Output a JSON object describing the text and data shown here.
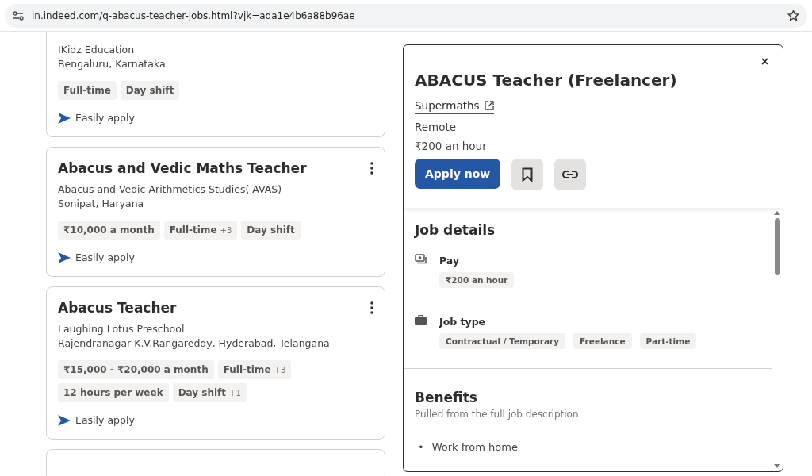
{
  "address_bar": {
    "url": "in.indeed.com/q-abacus-teacher-jobs.html?vjk=ada1e4b6a88b96ae",
    "bookmarked": false
  },
  "job_cards": [
    {
      "cut_top": true,
      "company": "IKidz Education",
      "location": "Bengaluru, Karnataka",
      "tags": [
        {
          "label": "Full-time"
        },
        {
          "label": "Day shift"
        }
      ],
      "apply": "Easily apply"
    },
    {
      "cut_top": false,
      "title": "Abacus and Vedic Maths Teacher",
      "company": "Abacus and Vedic Arithmetics Studies( AVAS)",
      "location": "Sonipat, Haryana",
      "tags": [
        {
          "label": "₹10,000 a month"
        },
        {
          "label": "Full-time",
          "more": "+3"
        },
        {
          "label": "Day shift"
        }
      ],
      "apply": "Easily apply"
    },
    {
      "cut_top": false,
      "title": "Abacus Teacher",
      "company": "Laughing Lotus Preschool",
      "location": "Rajendranagar K.V.Rangareddy, Hyderabad, Telangana",
      "tags": [
        {
          "label": "₹15,000 - ₹20,000 a month"
        },
        {
          "label": "Full-time",
          "more": "+3"
        },
        {
          "label": "12 hours per week"
        },
        {
          "label": "Day shift",
          "more": "+1"
        }
      ],
      "apply": "Easily apply"
    }
  ],
  "detail": {
    "close": "×",
    "title": "ABACUS Teacher (Freelancer)",
    "company": "Supermaths",
    "location": "Remote",
    "pay": "₹200 an hour",
    "apply_button": "Apply now",
    "job_details": {
      "heading": "Job details",
      "sections": [
        {
          "kind": "pay",
          "label": "Pay",
          "tags": [
            "₹200 an hour"
          ]
        },
        {
          "kind": "jobtype",
          "label": "Job type",
          "tags": [
            "Contractual / Temporary",
            "Freelance",
            "Part-time"
          ]
        }
      ]
    },
    "benefits": {
      "heading": "Benefits",
      "note": "Pulled from the full job description",
      "bullet": "•",
      "items": [
        "Work from home"
      ]
    }
  }
}
